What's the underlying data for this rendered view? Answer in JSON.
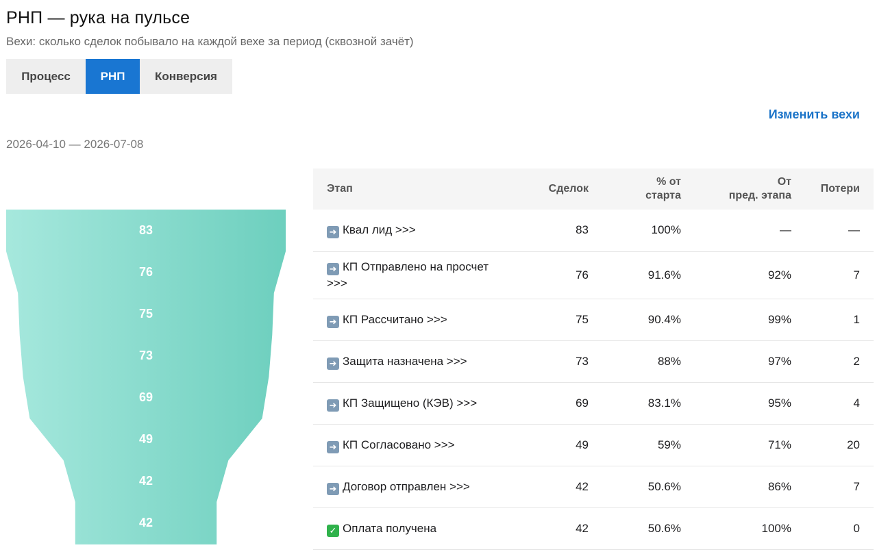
{
  "header": {
    "title": "РНП — рука на пульсе",
    "subtitle": "Вехи: сколько сделок побывало на каждой вехе за период (сквозной зачёт)"
  },
  "tabs": [
    {
      "label": "Процесс",
      "active": false
    },
    {
      "label": "РНП",
      "active": true
    },
    {
      "label": "Конверсия",
      "active": false
    }
  ],
  "edit_link": "Изменить вехи",
  "date_range": "2026-04-10 — 2026-07-08",
  "colors": {
    "accent": "#1976d2",
    "link": "#1a73c8",
    "funnel_light": "#a6e8dd",
    "funnel_dark": "#6dcfbe"
  },
  "funnel": {
    "values": [
      "83",
      "76",
      "75",
      "73",
      "69",
      "49",
      "42",
      "42"
    ]
  },
  "table": {
    "headers": {
      "stage": "Этап",
      "deals": "Сделок",
      "pct_start_1": "% от",
      "pct_start_2": "старта",
      "pct_prev_1": "От",
      "pct_prev_2": "пред. этапа",
      "losses": "Потери"
    },
    "rows": [
      {
        "icon": "arrow-right-icon",
        "stage": "Квал лид >>>",
        "deals": "83",
        "pct_start": "100%",
        "pct_prev": "—",
        "losses": "—"
      },
      {
        "icon": "arrow-right-icon",
        "stage": "КП Отправлено на просчет >>>",
        "deals": "76",
        "pct_start": "91.6%",
        "pct_prev": "92%",
        "losses": "7"
      },
      {
        "icon": "arrow-right-icon",
        "stage": "КП Рассчитано >>>",
        "deals": "75",
        "pct_start": "90.4%",
        "pct_prev": "99%",
        "losses": "1"
      },
      {
        "icon": "arrow-right-icon",
        "stage": "Защита назначена >>>",
        "deals": "73",
        "pct_start": "88%",
        "pct_prev": "97%",
        "losses": "2"
      },
      {
        "icon": "arrow-right-icon",
        "stage": "КП Защищено (КЭВ) >>>",
        "deals": "69",
        "pct_start": "83.1%",
        "pct_prev": "95%",
        "losses": "4"
      },
      {
        "icon": "arrow-right-icon",
        "stage": "КП Согласовано >>>",
        "deals": "49",
        "pct_start": "59%",
        "pct_prev": "71%",
        "losses": "20"
      },
      {
        "icon": "arrow-right-icon",
        "stage": "Договор отправлен >>>",
        "deals": "42",
        "pct_start": "50.6%",
        "pct_prev": "86%",
        "losses": "7"
      },
      {
        "icon": "check-mark-icon",
        "stage": "Оплата получена",
        "deals": "42",
        "pct_start": "50.6%",
        "pct_prev": "100%",
        "losses": "0"
      }
    ]
  }
}
